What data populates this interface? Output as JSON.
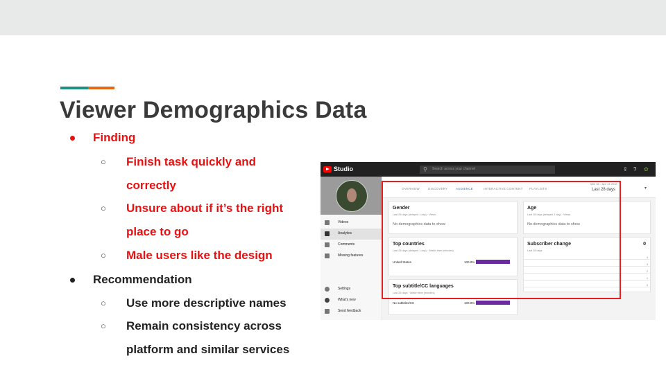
{
  "slide": {
    "title": "Viewer Demographics Data",
    "bullets": {
      "finding": "Finding",
      "finding_items": [
        "Finish task quickly and",
        "correctly",
        "Unsure about if it’s the right",
        "place to go",
        "Male users like the design"
      ],
      "recommendation": "Recommendation",
      "recommendation_items": [
        "Use more descriptive names",
        "Remain consistency across",
        "platform and similar services"
      ]
    },
    "colors": {
      "accent_teal": "#1e8f86",
      "accent_orange": "#e06a17",
      "finding_red": "#e81010",
      "title_gray": "#3a3a3a"
    }
  },
  "studio": {
    "app_name": "Studio",
    "search_placeholder": "Search across your channel",
    "icons": {
      "search": "search-icon",
      "upload": "upload-icon",
      "help": "help-icon",
      "avatar": "account-avatar"
    },
    "sidebar": {
      "items": [
        {
          "label": "Videos",
          "icon": "videos-icon"
        },
        {
          "label": "Analytics",
          "icon": "analytics-icon",
          "active": true
        },
        {
          "label": "Comments",
          "icon": "comments-icon"
        },
        {
          "label": "Missing features",
          "icon": "missing-features-icon"
        }
      ],
      "bottom": [
        {
          "label": "Settings",
          "icon": "gear-icon"
        },
        {
          "label": "What's new",
          "icon": "info-icon"
        },
        {
          "label": "Send feedback",
          "icon": "feedback-icon"
        }
      ]
    },
    "tabs": [
      "OVERVIEW",
      "DISCOVERY",
      "AUDIENCE",
      "INTERACTIVE CONTENT",
      "PLAYLISTS"
    ],
    "active_tab": "AUDIENCE",
    "date_range": "Mar 18 – Apr 14 2018",
    "date_main": "Last 28 days",
    "cards": {
      "gender": {
        "title": "Gender",
        "sub": "Last 28 days (delayed 1 day) · Views",
        "empty": "No demographics data to show"
      },
      "age": {
        "title": "Age",
        "sub": "Last 28 days (delayed 1 day) · Views",
        "empty": "No demographics data to show"
      },
      "countries": {
        "title": "Top countries",
        "sub": "Last 28 days (delayed 1 day) · Watch time (minutes)",
        "row_label": "United States",
        "row_pct": "100.0%"
      },
      "subscriber": {
        "title": "Subscriber change",
        "sub": "Last 28 days",
        "value": "0",
        "ticks": [
          "4",
          "3",
          "2",
          "1",
          "0"
        ]
      },
      "subtitles": {
        "title": "Top subtitle/CC languages",
        "sub": "Last 28 days · Watch time (minutes)",
        "row_label": "No subtitles/CC",
        "row_pct": "100.0%"
      }
    },
    "colors": {
      "highlight_box": "#e3201f",
      "bar": "#6a2b9c",
      "tab_active": "#3b6ec4"
    }
  }
}
